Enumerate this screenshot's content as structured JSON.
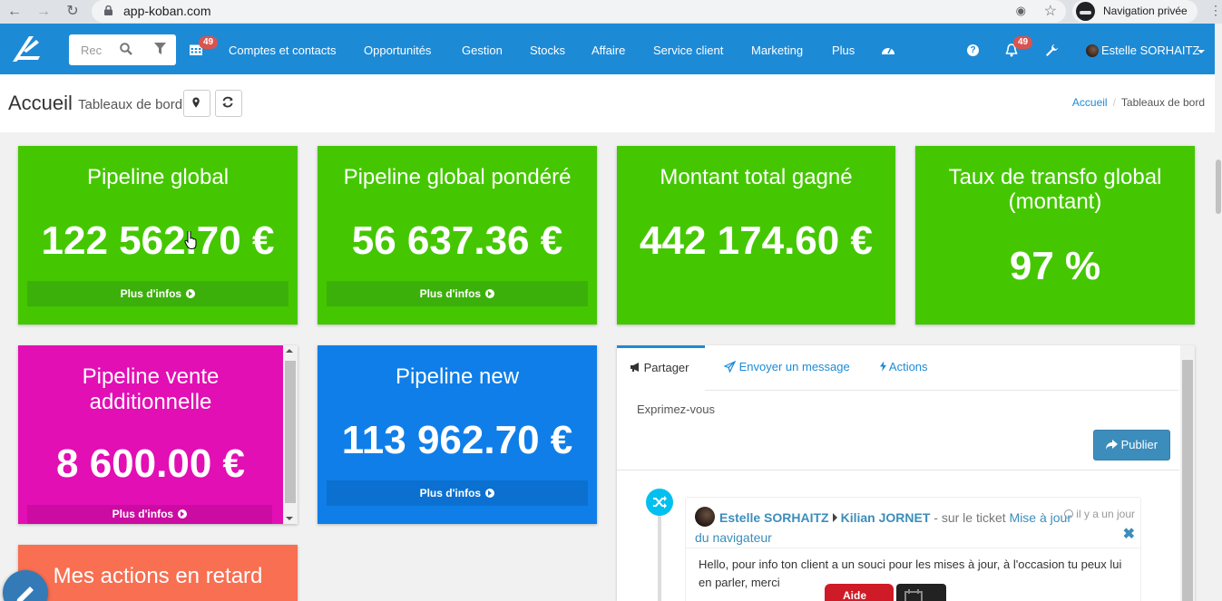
{
  "browser": {
    "url": "app-koban.com",
    "private_label": "Navigation privée"
  },
  "topnav": {
    "search_placeholder": "Rec",
    "calendar_badge": "49",
    "items": [
      {
        "label": "Comptes et contacts"
      },
      {
        "label": "Opportunités"
      },
      {
        "label": "Gestion"
      },
      {
        "label": "Stocks"
      },
      {
        "label": "Affaire"
      },
      {
        "label": "Service client"
      },
      {
        "label": "Marketing"
      },
      {
        "label": "Plus"
      }
    ],
    "notifications_badge": "49",
    "help_glyph": "?",
    "user_name": "Estelle SORHAITZ"
  },
  "header": {
    "title": "Accueil",
    "subtitle": "Tableaux de bord",
    "breadcrumb_home": "Accueil",
    "breadcrumb_separator": "/",
    "breadcrumb_current": "Tableaux de bord"
  },
  "cards": [
    {
      "title": "Pipeline global",
      "value": "122 562.70 €",
      "more": "Plus d'infos"
    },
    {
      "title": "Pipeline global pondéré",
      "value": "56 637.36 €",
      "more": "Plus d'infos"
    },
    {
      "title": "Montant total gagné",
      "value": "442 174.60 €"
    },
    {
      "title_line1": "Taux de transfo global",
      "title_line2": "(montant)",
      "value": "97 %"
    },
    {
      "title_line1": "Pipeline vente",
      "title_line2": "additionnelle",
      "value": "8 600.00 €",
      "more": "Plus d'infos"
    },
    {
      "title": "Pipeline new",
      "value": "113 962.70 €",
      "more": "Plus d'infos"
    },
    {
      "title": "Mes actions en retard"
    }
  ],
  "share": {
    "tabs": [
      {
        "label": "Partager"
      },
      {
        "label": "Envoyer un message"
      },
      {
        "label": "Actions"
      }
    ],
    "placeholder": "Exprimez-vous",
    "publish_label": "Publier",
    "post": {
      "author": "Estelle SORHAITZ",
      "target": "Kilian JORNET",
      "connector": " - sur le ticket ",
      "ticket": "Mise à jour du navigateur",
      "time": "il y a un jour",
      "close_glyph": "✖",
      "body": "Hello, pour info ton client a un souci pour les mises à jour, à l'occasion tu peux lui en parler, merci"
    },
    "help_label": "Aide"
  },
  "colors": {
    "nav_blue": "#1d8ad6",
    "card_green": "#44c700",
    "card_pink": "#e20fb4",
    "card_blue": "#0f7ee8",
    "card_orange": "#f86f52"
  }
}
